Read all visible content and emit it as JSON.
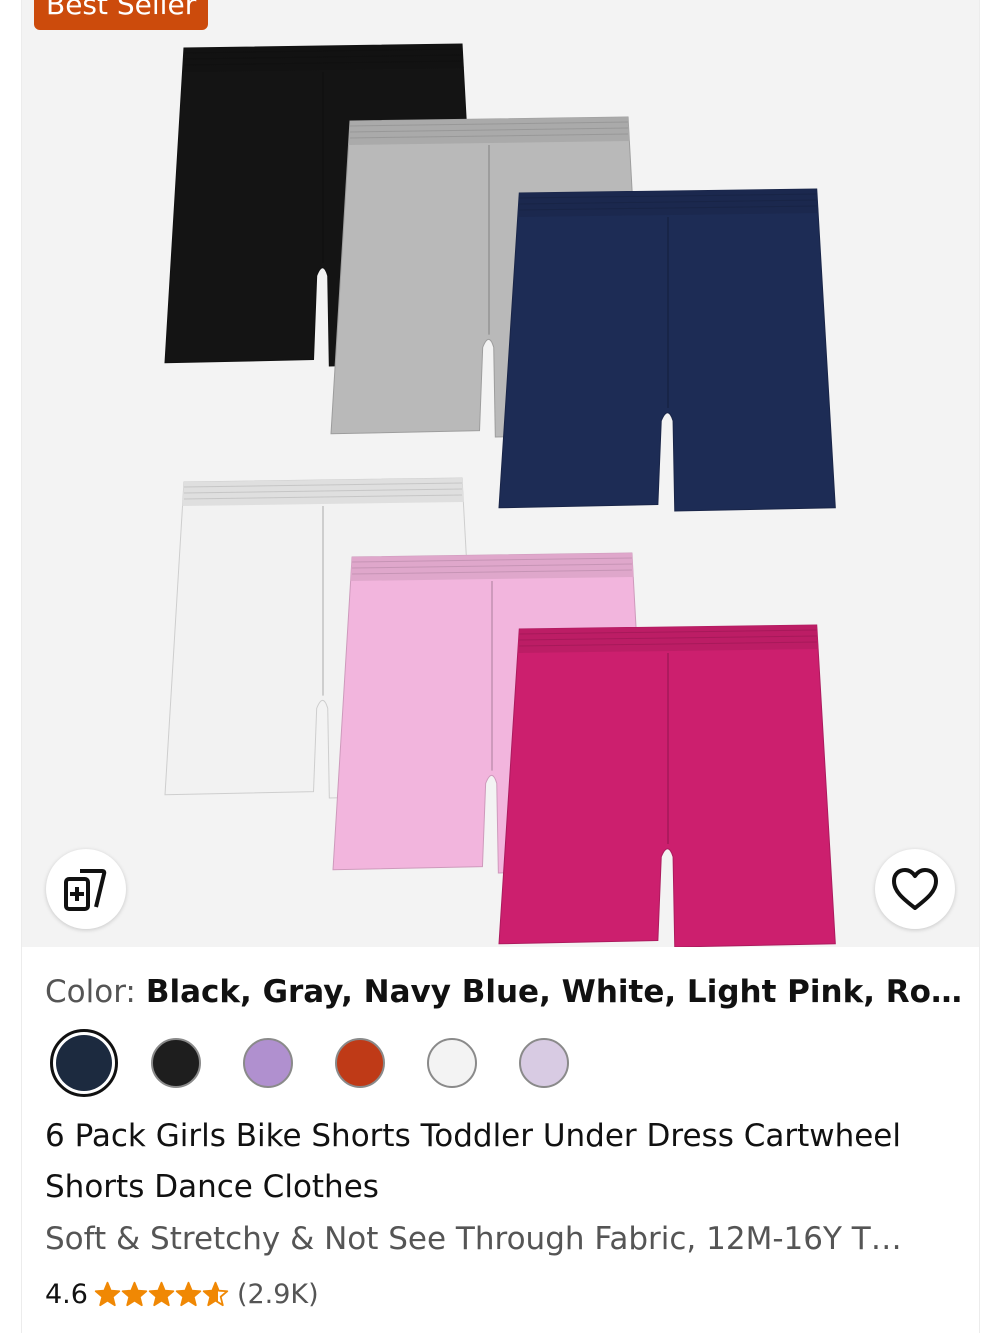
{
  "badge": {
    "label": "Best Seller",
    "color": "#cc4b0c"
  },
  "product_image": {
    "alt": "6 pairs of shorts",
    "shorts_colors": [
      "#141414",
      "#b9b9b9",
      "#1d2c55",
      "#f2f2f2",
      "#f2b5dd",
      "#cc1f6e"
    ]
  },
  "actions": {
    "compare_icon": "add-to-compare-icon",
    "wishlist_icon": "heart-outline-icon"
  },
  "color": {
    "label": "Color:",
    "value": "Black, Gray, Navy Blue, White, Light Pink, Ro…"
  },
  "swatches": [
    {
      "name": "navy",
      "color": "#1c2a3f",
      "selected": true
    },
    {
      "name": "black",
      "color": "#1e1e1e",
      "selected": false
    },
    {
      "name": "purple",
      "color": "#b090cf",
      "selected": false
    },
    {
      "name": "rust",
      "color": "#bf3a17",
      "selected": false
    },
    {
      "name": "white",
      "color": "#f3f3f3",
      "selected": false
    },
    {
      "name": "lavender",
      "color": "#d8cbe3",
      "selected": false
    }
  ],
  "title": "6 Pack Girls Bike Shorts Toddler Under Dress Cartwheel Shorts Dance Clothes",
  "subtitle": "Soft & Stretchy & Not See Through Fabric, 12M-16Y T…",
  "rating": {
    "value": "4.6",
    "stars_filled": 4.6,
    "star_color": "#f08804",
    "count": "(2.9K)"
  }
}
